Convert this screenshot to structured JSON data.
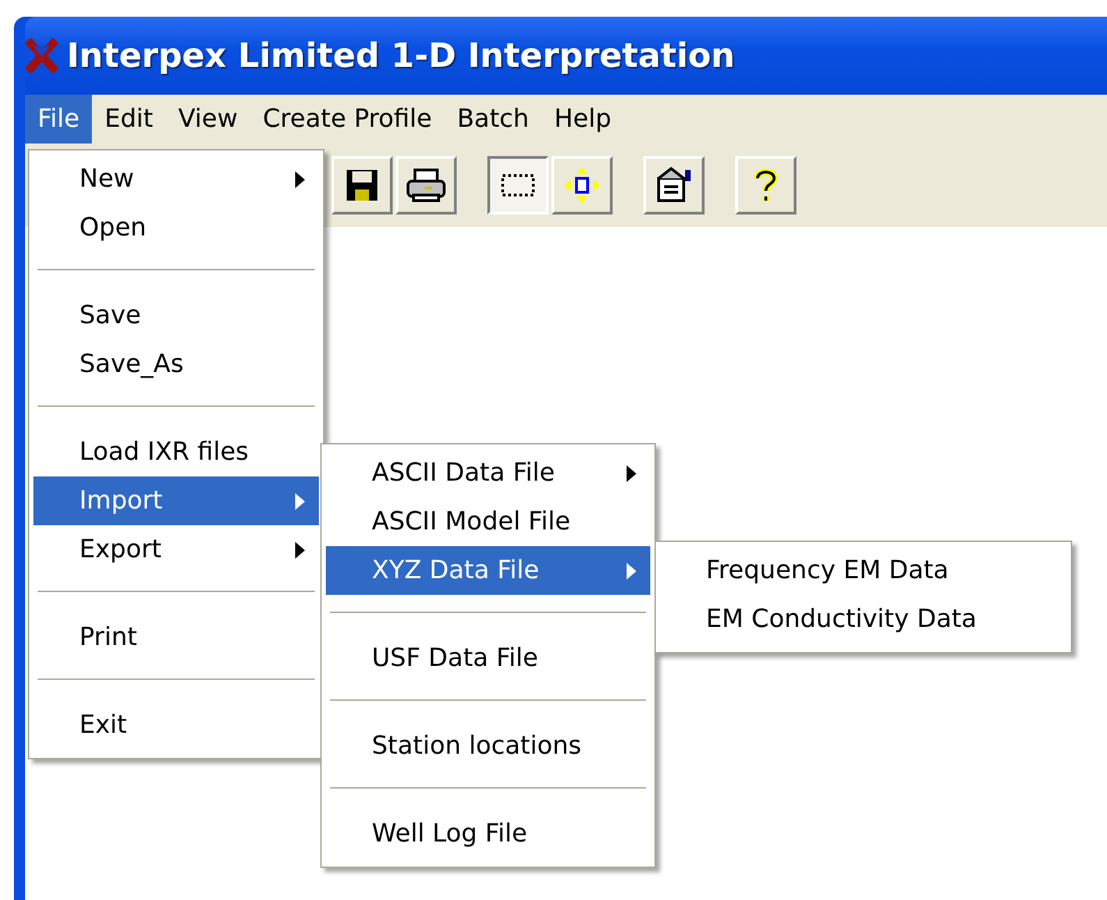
{
  "window": {
    "title": "Interpex Limited 1-D Interpretation"
  },
  "menubar": [
    {
      "label": "File",
      "selected": true
    },
    {
      "label": "Edit",
      "selected": false
    },
    {
      "label": "View",
      "selected": false
    },
    {
      "label": "Create Profile",
      "selected": false
    },
    {
      "label": "Batch",
      "selected": false
    },
    {
      "label": "Help",
      "selected": false
    }
  ],
  "toolbar": [
    {
      "kind": "save",
      "pressed": false
    },
    {
      "kind": "print",
      "pressed": false
    },
    {
      "kind": "select",
      "pressed": true
    },
    {
      "kind": "move",
      "pressed": false
    },
    {
      "kind": "properties",
      "pressed": false
    },
    {
      "kind": "help",
      "pressed": false
    }
  ],
  "file_menu": [
    {
      "kind": "item",
      "label": "New",
      "submenu_arrow": true,
      "selected": false
    },
    {
      "kind": "item",
      "label": "Open",
      "submenu_arrow": false,
      "selected": false
    },
    {
      "kind": "separator"
    },
    {
      "kind": "item",
      "label": "Save",
      "submenu_arrow": false,
      "selected": false
    },
    {
      "kind": "item",
      "label": "Save_As",
      "submenu_arrow": false,
      "selected": false
    },
    {
      "kind": "separator"
    },
    {
      "kind": "item",
      "label": "Load IXR files",
      "submenu_arrow": false,
      "selected": false
    },
    {
      "kind": "item",
      "label": "Import",
      "submenu_arrow": true,
      "selected": true,
      "children": [
        {
          "kind": "item",
          "label": "ASCII Data File",
          "submenu_arrow": true,
          "selected": false
        },
        {
          "kind": "item",
          "label": "ASCII Model File",
          "submenu_arrow": false,
          "selected": false
        },
        {
          "kind": "item",
          "label": "XYZ Data File",
          "submenu_arrow": true,
          "selected": true,
          "children": [
            {
              "kind": "item",
              "label": "Frequency EM Data",
              "submenu_arrow": false,
              "selected": false
            },
            {
              "kind": "item",
              "label": "EM Conductivity Data",
              "submenu_arrow": false,
              "selected": false
            }
          ]
        },
        {
          "kind": "separator"
        },
        {
          "kind": "item",
          "label": "USF Data File",
          "submenu_arrow": false,
          "selected": false
        },
        {
          "kind": "separator"
        },
        {
          "kind": "item",
          "label": "Station locations",
          "submenu_arrow": false,
          "selected": false
        },
        {
          "kind": "separator"
        },
        {
          "kind": "item",
          "label": "Well Log File",
          "submenu_arrow": false,
          "selected": false
        }
      ]
    },
    {
      "kind": "item",
      "label": "Export",
      "submenu_arrow": true,
      "selected": false
    },
    {
      "kind": "separator"
    },
    {
      "kind": "item",
      "label": "Print",
      "submenu_arrow": false,
      "selected": false
    },
    {
      "kind": "separator"
    },
    {
      "kind": "item",
      "label": "Exit",
      "submenu_arrow": false,
      "selected": false
    }
  ]
}
